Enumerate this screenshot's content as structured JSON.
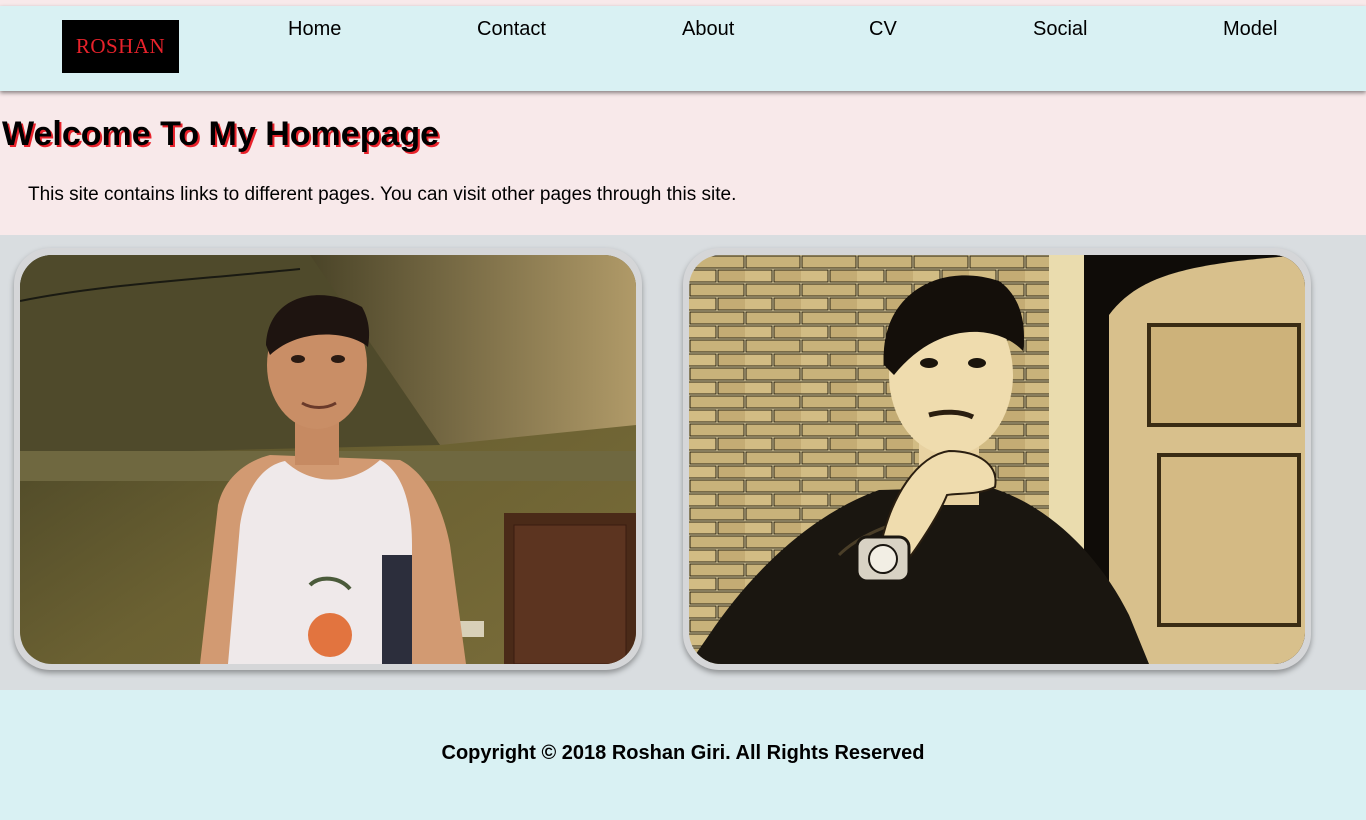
{
  "header": {
    "logo_text": "ROSHAN",
    "nav": [
      {
        "label": "Home"
      },
      {
        "label": "Contact"
      },
      {
        "label": "About"
      },
      {
        "label": "CV"
      },
      {
        "label": "Social"
      },
      {
        "label": "Model"
      }
    ]
  },
  "main": {
    "title": "Welcome To My Homepage",
    "intro": "This site contains links to different pages. You can visit other pages through this site."
  },
  "gallery": {
    "photos": [
      {
        "subject": "man-in-white-tank-top-photo"
      },
      {
        "subject": "man-posing-by-brick-wall-photo"
      }
    ]
  },
  "footer": {
    "copyright": "Copyright © 2018 Roshan Giri. All Rights Reserved"
  },
  "colors": {
    "header_bg": "#d9f1f3",
    "page_bg": "#f8e9ea",
    "gallery_bg": "#d9dde0",
    "accent_red": "#e8222b"
  }
}
